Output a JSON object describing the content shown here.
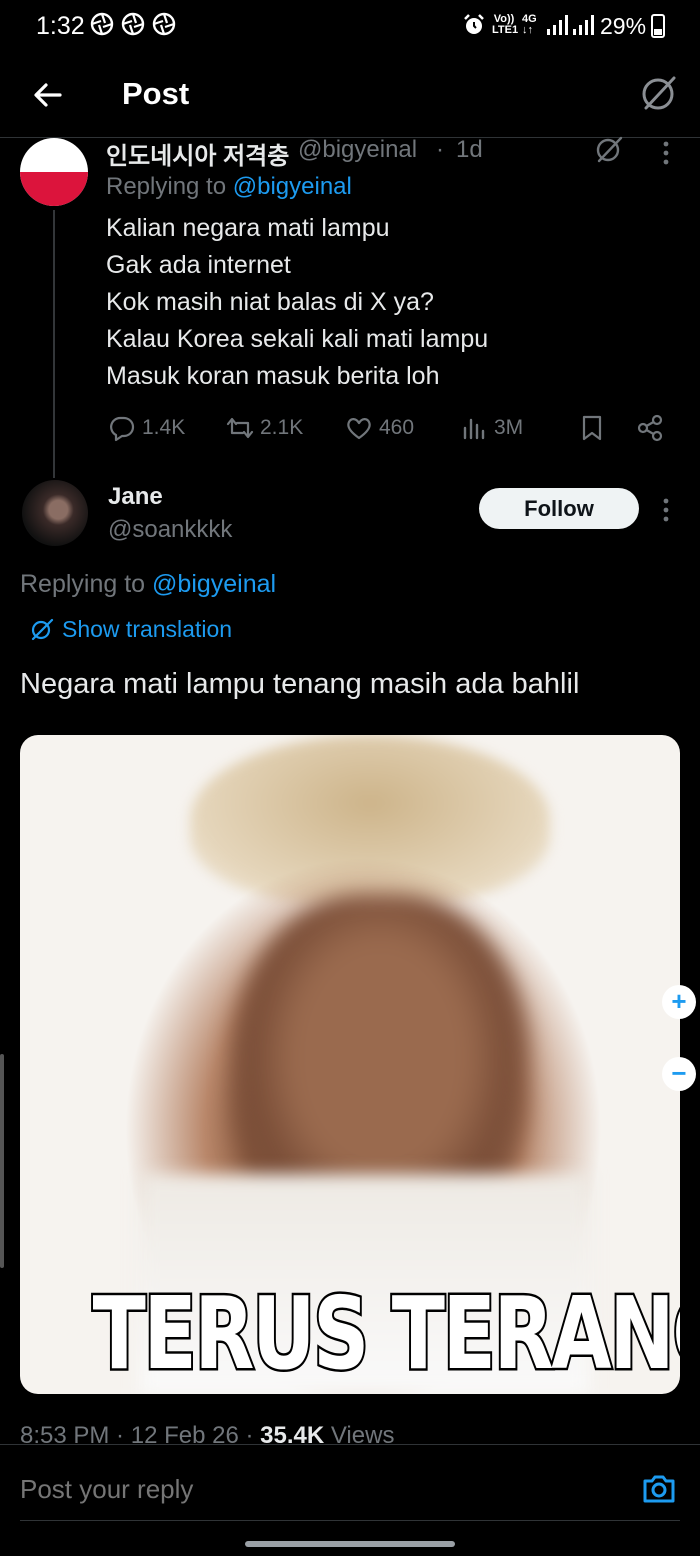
{
  "status_bar": {
    "time": "1:32",
    "net_label": "Vo))\nLTE1",
    "net_type": "4G\n↓↑",
    "battery": "29%"
  },
  "header": {
    "title": "Post"
  },
  "parent_post": {
    "display_name": "인도네시아 저격충",
    "handle": "@bigyeinal",
    "separator": "·",
    "time": "1d",
    "replying_prefix": "Replying to ",
    "replying_to": "@bigyeinal",
    "lines": [
      "Kalian negara mati lampu",
      "Gak ada internet",
      "Kok masih niat balas di X ya?",
      "Kalau Korea sekali kali mati lampu",
      "Masuk koran masuk berita loh"
    ],
    "stats": {
      "replies": "1.4K",
      "reposts": "2.1K",
      "likes": "460",
      "views": "3M"
    }
  },
  "reply_post": {
    "display_name": "Jane",
    "handle": "@soankkkk",
    "follow_label": "Follow",
    "replying_prefix": "Replying to ",
    "replying_to": "@bigyeinal",
    "show_translation": "Show translation",
    "text": "Negara mati lampu tenang masih ada bahlil",
    "media_caption": "TERUS TERANG",
    "timestamp_time": "8:53 PM",
    "timestamp_date": "12 Feb 26",
    "views_count": "35.4K",
    "views_label": "Views"
  },
  "zoom": {
    "plus": "+",
    "minus": "−"
  },
  "composer": {
    "placeholder": "Post your reply"
  },
  "colors": {
    "background": "#000000",
    "accent": "#1d9bf0",
    "muted": "#71767b",
    "text": "#e7e9ea"
  },
  "icons": {
    "status": [
      "aperture-icon",
      "aperture-icon",
      "aperture-icon",
      "alarm-icon",
      "signal-icon",
      "signal-icon",
      "battery-icon"
    ],
    "header": [
      "back-arrow-icon",
      "grok-icon"
    ],
    "actions": [
      "reply-icon",
      "repost-icon",
      "like-icon",
      "views-icon",
      "bookmark-icon",
      "share-icon"
    ],
    "composer": [
      "camera-icon"
    ]
  }
}
